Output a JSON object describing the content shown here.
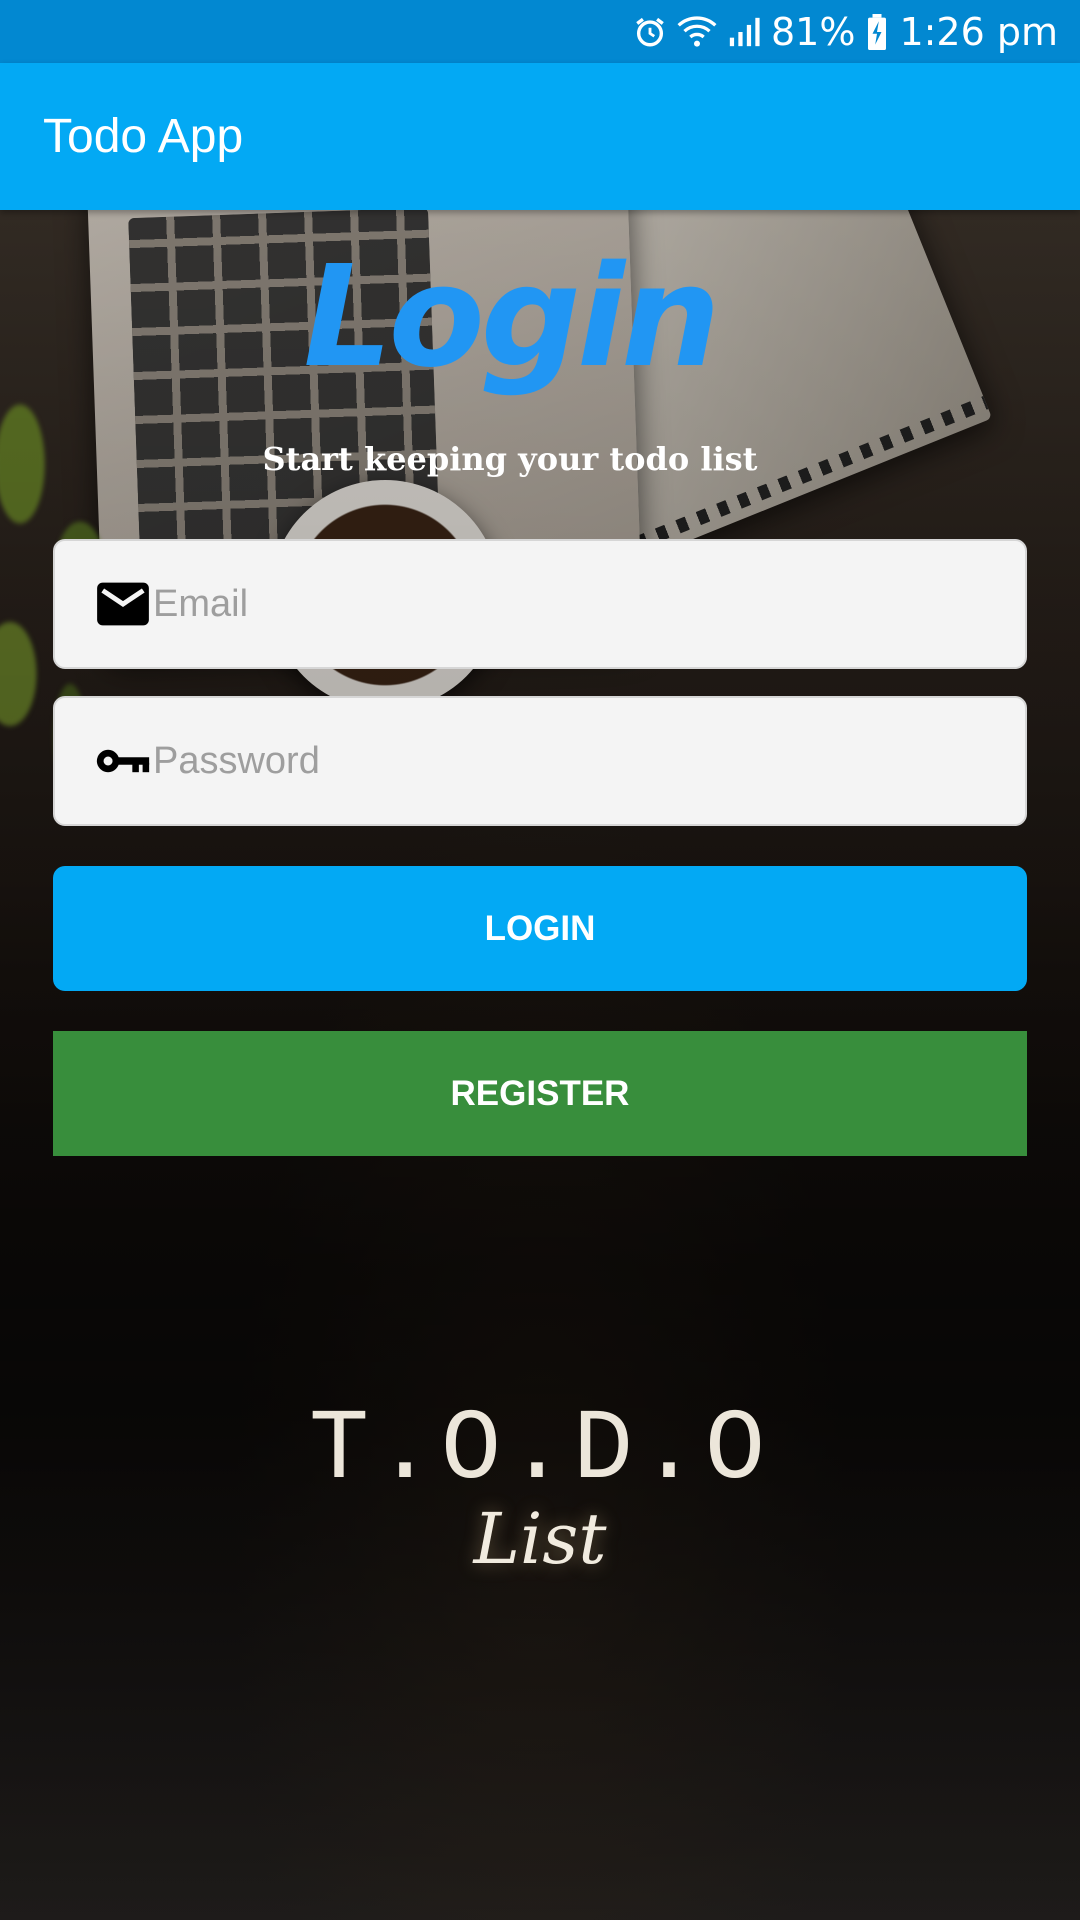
{
  "status_bar": {
    "battery": "81%",
    "time": "1:26 pm",
    "icons": [
      "alarm-icon",
      "wifi-icon",
      "signal-icon",
      "battery-charging-icon"
    ]
  },
  "app_bar": {
    "title": "Todo App"
  },
  "login": {
    "heading": "Login",
    "subtitle": "Start keeping your todo list",
    "email": {
      "placeholder": "Email",
      "value": "",
      "icon": "email-icon"
    },
    "password": {
      "placeholder": "Password",
      "value": "",
      "icon": "key-icon"
    },
    "login_label": "LOGIN",
    "register_label": "REGISTER"
  },
  "logo": {
    "title": "T.O.D.O",
    "subtitle": "List"
  },
  "colors": {
    "status_bar": "#0288d1",
    "app_bar": "#03a9f4",
    "heading": "#2196f3",
    "login_button": "#03a9f4",
    "register_button": "#388e3c"
  }
}
